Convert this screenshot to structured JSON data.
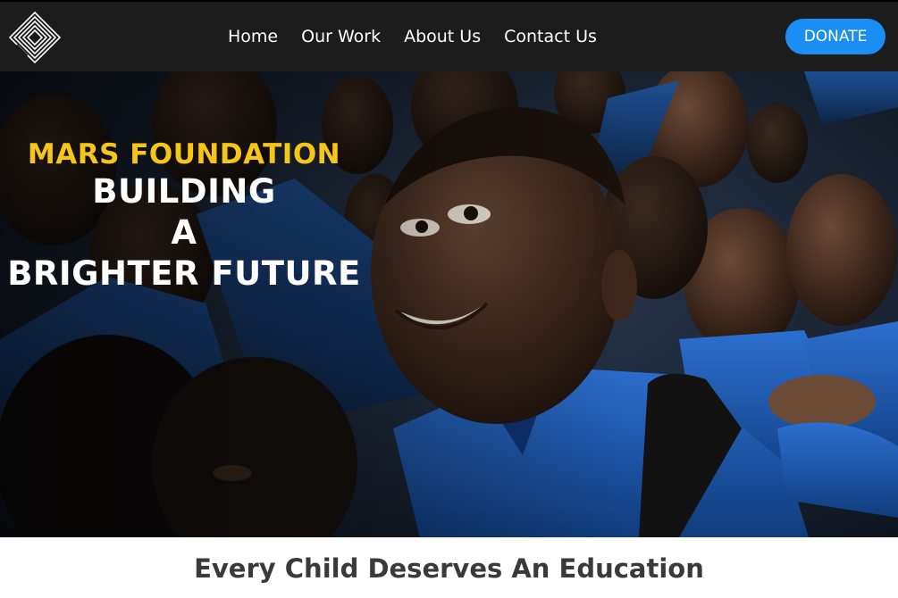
{
  "header": {
    "logo_icon": "diamond-lines-logo-icon",
    "nav_items": [
      {
        "label": "Home"
      },
      {
        "label": "Our Work"
      },
      {
        "label": "About Us"
      },
      {
        "label": "Contact Us"
      }
    ],
    "donate_label": "DONATE"
  },
  "hero": {
    "foundation": "MARS FOUNDATION",
    "line1": "BUILDING",
    "line2": "A",
    "line3": "BRIGHTER FUTURE",
    "image_subject": "schoolchildren-in-blue-uniforms-photo"
  },
  "main": {
    "heading": "Every Child Deserves An Education"
  },
  "colors": {
    "navbar_bg": "#1c1c1c",
    "donate_bg": "#1a8ef2",
    "accent_yellow": "#f5c518",
    "uniform_blue": "#1f5fb8"
  }
}
